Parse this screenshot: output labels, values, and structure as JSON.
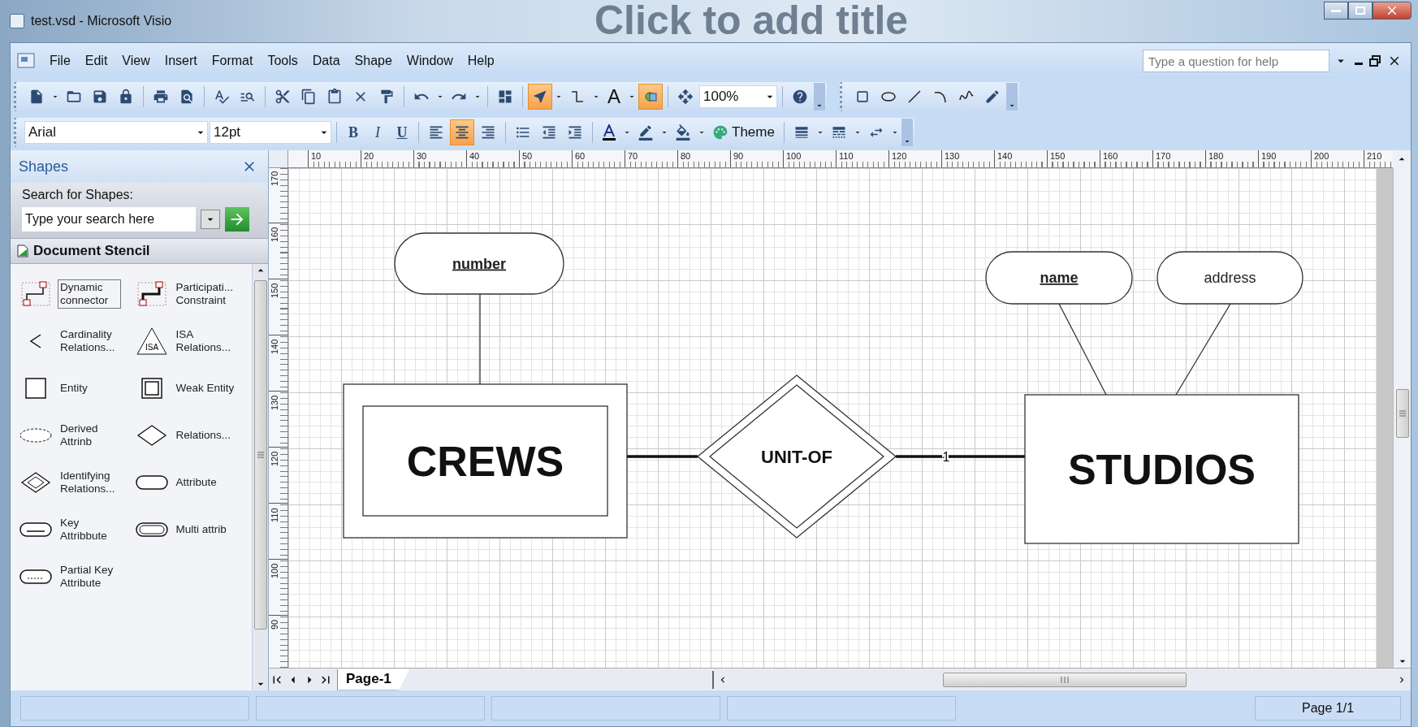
{
  "window": {
    "title": "test.vsd - Microsoft Visio",
    "background_text": "Click to add title"
  },
  "menu": {
    "items": [
      "File",
      "Edit",
      "View",
      "Insert",
      "Format",
      "Tools",
      "Data",
      "Shape",
      "Window",
      "Help"
    ],
    "help_placeholder": "Type a question for help"
  },
  "toolbar_standard": [
    {
      "kind": "new",
      "selected": false
    },
    {
      "kind": "dropdown"
    },
    {
      "kind": "open",
      "selected": false
    },
    {
      "kind": "save",
      "selected": false
    },
    {
      "kind": "permission",
      "selected": false
    },
    {
      "kind": "separator"
    },
    {
      "kind": "print",
      "selected": false
    },
    {
      "kind": "preview",
      "selected": false
    },
    {
      "kind": "separator"
    },
    {
      "kind": "spelling",
      "selected": false
    },
    {
      "kind": "research",
      "selected": false
    },
    {
      "kind": "separator"
    },
    {
      "kind": "cut",
      "selected": false
    },
    {
      "kind": "copy",
      "selected": false
    },
    {
      "kind": "paste",
      "selected": false
    },
    {
      "kind": "delete",
      "selected": false
    },
    {
      "kind": "painter",
      "selected": false
    },
    {
      "kind": "separator"
    },
    {
      "kind": "undo",
      "selected": false
    },
    {
      "kind": "dropdown"
    },
    {
      "kind": "redo",
      "selected": false
    },
    {
      "kind": "dropdown"
    },
    {
      "kind": "separator"
    },
    {
      "kind": "shapes",
      "selected": false
    },
    {
      "kind": "separator"
    },
    {
      "kind": "pointer",
      "selected": true
    },
    {
      "kind": "dropdown"
    },
    {
      "kind": "connector",
      "selected": false
    },
    {
      "kind": "dropdown"
    },
    {
      "kind": "text",
      "label": "A",
      "selected": false
    },
    {
      "kind": "dropdown"
    },
    {
      "kind": "connection",
      "selected": true
    },
    {
      "kind": "separator"
    },
    {
      "kind": "pan",
      "selected": false
    },
    {
      "kind": "zoom",
      "value": "100%"
    },
    {
      "kind": "separator"
    },
    {
      "kind": "help",
      "selected": false
    },
    {
      "kind": "overflow"
    }
  ],
  "toolbar_drawing": [
    {
      "kind": "rectangle",
      "selected": false
    },
    {
      "kind": "ellipse",
      "selected": false
    },
    {
      "kind": "line",
      "selected": false
    },
    {
      "kind": "arc",
      "selected": false
    },
    {
      "kind": "freeform",
      "selected": false
    },
    {
      "kind": "pencil",
      "selected": false
    },
    {
      "kind": "overflow"
    }
  ],
  "toolbar_format": [
    {
      "kind": "font",
      "value": "Arial"
    },
    {
      "kind": "size",
      "value": "12pt"
    },
    {
      "kind": "separator"
    },
    {
      "kind": "bold",
      "label": "B",
      "selected": false
    },
    {
      "kind": "italic",
      "label": "I",
      "selected": false
    },
    {
      "kind": "underline",
      "label": "U",
      "selected": false
    },
    {
      "kind": "separator"
    },
    {
      "kind": "align-left",
      "selected": false
    },
    {
      "kind": "align-center",
      "selected": true
    },
    {
      "kind": "align-right",
      "selected": false
    },
    {
      "kind": "separator"
    },
    {
      "kind": "bullets",
      "selected": false
    },
    {
      "kind": "outdent",
      "selected": false
    },
    {
      "kind": "indent",
      "selected": false
    },
    {
      "kind": "separator"
    },
    {
      "kind": "font-color",
      "selected": false
    },
    {
      "kind": "dropdown"
    },
    {
      "kind": "line-color",
      "selected": false
    },
    {
      "kind": "dropdown"
    },
    {
      "kind": "fill",
      "selected": false
    },
    {
      "kind": "dropdown"
    },
    {
      "kind": "theme",
      "label": "Theme",
      "selected": false
    },
    {
      "kind": "separator"
    },
    {
      "kind": "line-weight",
      "selected": false
    },
    {
      "kind": "dropdown"
    },
    {
      "kind": "line-pattern",
      "selected": false
    },
    {
      "kind": "dropdown"
    },
    {
      "kind": "line-ends",
      "selected": false
    },
    {
      "kind": "dropdown"
    },
    {
      "kind": "overflow"
    }
  ],
  "shapes_panel": {
    "title": "Shapes",
    "search_label": "Search for Shapes:",
    "search_placeholder": "Type your search here",
    "stencil_title": "Document Stencil",
    "items": [
      {
        "kind": "dynamic-connector",
        "label": "Dynamic connector",
        "selected": true
      },
      {
        "kind": "participation",
        "label": "Participati... Constraint",
        "selected": false
      },
      {
        "kind": "cardinality",
        "label": "Cardinality Relations...",
        "selected": false
      },
      {
        "kind": "isa",
        "label": "ISA Relations...",
        "icon_text": "ISA",
        "selected": false
      },
      {
        "kind": "entity",
        "label": "Entity",
        "selected": false
      },
      {
        "kind": "weak-entity",
        "label": "Weak Entity",
        "selected": false
      },
      {
        "kind": "derived",
        "label": "Derived Attrinb",
        "selected": false
      },
      {
        "kind": "relationship",
        "label": "Relations...",
        "selected": false
      },
      {
        "kind": "identifying",
        "label": "Identifying Relations...",
        "selected": false
      },
      {
        "kind": "attribute",
        "label": "Attribute",
        "selected": false
      },
      {
        "kind": "key",
        "label": "Key Attribbute",
        "selected": false
      },
      {
        "kind": "multi",
        "label": "Multi attrib",
        "selected": false
      },
      {
        "kind": "partial-key",
        "label": "Partial Key Attribute",
        "selected": false
      }
    ]
  },
  "rulers": {
    "horizontal": [
      "10",
      "20",
      "30",
      "40",
      "50",
      "60",
      "70",
      "80",
      "90",
      "100",
      "110",
      "120",
      "130",
      "140",
      "150",
      "160",
      "170",
      "180",
      "190",
      "200",
      "210"
    ],
    "vertical": [
      "170",
      "160",
      "150",
      "140",
      "130",
      "120",
      "110",
      "100",
      "90"
    ]
  },
  "diagram": {
    "attributes": [
      {
        "label": "number",
        "key": true
      },
      {
        "label": "name",
        "key": true
      },
      {
        "label": "address",
        "key": false
      }
    ],
    "entities": [
      {
        "label": "CREWS",
        "weak": true
      },
      {
        "label": "STUDIOS",
        "weak": false
      }
    ],
    "relationship": {
      "label": "UNIT-OF",
      "identifying": true
    },
    "cardinality": "1"
  },
  "page_tabs": [
    {
      "label": "Page-1",
      "selected": true
    }
  ],
  "status_bar": {
    "page": "Page 1/1"
  }
}
